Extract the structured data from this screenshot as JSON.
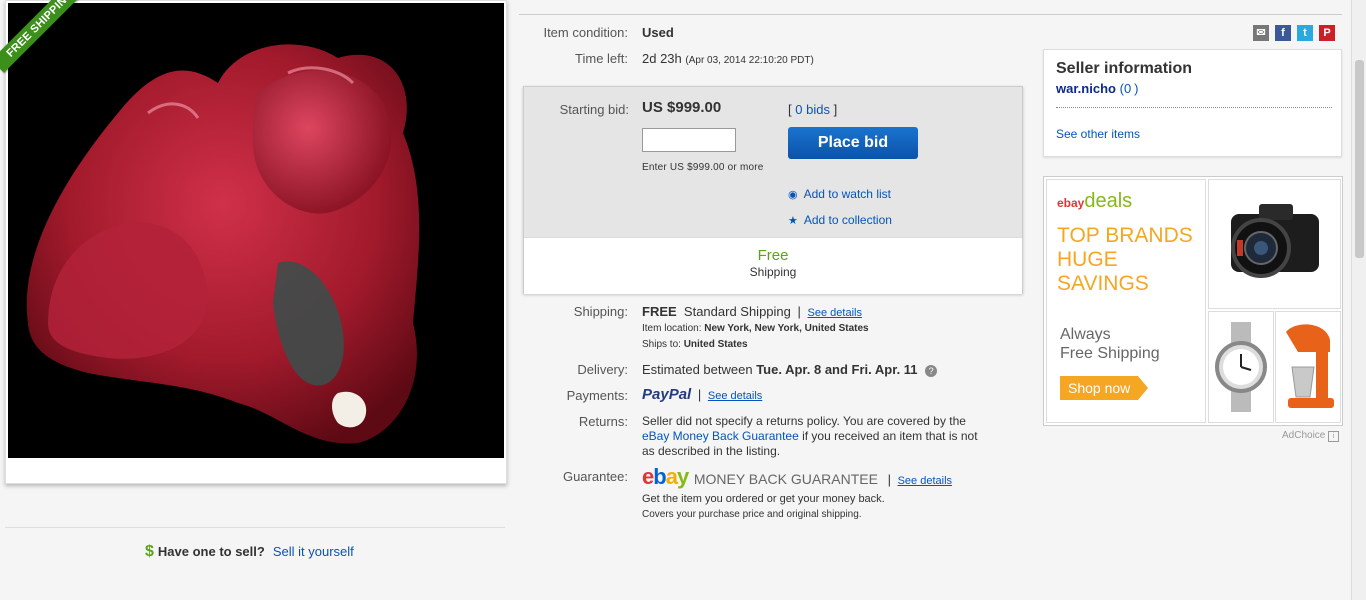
{
  "ribbon": "FREE SHIPPING",
  "sell": {
    "question": "Have one to sell?",
    "link": "Sell it yourself",
    "icon": "dollar-icon"
  },
  "details": {
    "condition_label": "Item condition:",
    "condition_value": "Used",
    "time_label": "Time left:",
    "time_value": "2d 23h",
    "time_detail": "(Apr 03, 2014  22:10:20 PDT)"
  },
  "bid": {
    "starting_label": "Starting bid:",
    "starting_value": "US $999.00",
    "bids_open": "[",
    "bids_link": "0 bids",
    "bids_close": "]",
    "input_value": "",
    "hint": "Enter US $999.00 or more",
    "place_bid": "Place bid",
    "watch": "Add to watch list",
    "collection": "Add to collection",
    "ship_title": "Free",
    "ship_sub": "Shipping"
  },
  "shipping": {
    "label": "Shipping:",
    "free": "FREE",
    "method": "Standard Shipping",
    "see_details": "See details",
    "location_label": "Item location:",
    "location_value": "New York, New York, United States",
    "ships_label": "Ships to:",
    "ships_value": "United States"
  },
  "delivery": {
    "label": "Delivery:",
    "prefix": "Estimated between",
    "dates": "Tue. Apr. 8 and Fri. Apr. 11"
  },
  "payments": {
    "label": "Payments:",
    "paypal": "PayPal",
    "see_details": "See details"
  },
  "returns": {
    "label": "Returns:",
    "line1": "Seller did not specify a returns policy. You are covered by the",
    "link": "eBay Money Back Guarantee",
    "line2": " if you received an item that is not",
    "line3": "as described in the listing."
  },
  "guarantee": {
    "label": "Guarantee:",
    "ebay": "ebay",
    "title": "MONEY BACK GUARANTEE",
    "see_details": "See details",
    "line1": "Get the item you ordered or get your money back.",
    "line2": "Covers your purchase price and original shipping."
  },
  "seller": {
    "title": "Seller information",
    "name": "war.nicho",
    "feedback_open": "(",
    "feedback": "0",
    "feedback_close": ")",
    "see_other": "See other items"
  },
  "ad": {
    "logo_ebay": "ebay",
    "logo_deals": "deals",
    "line1": "TOP BRANDS",
    "line2": "HUGE",
    "line3": "SAVINGS",
    "always1": "Always",
    "always2": "Free Shipping",
    "cta": "Shop now",
    "adchoice": "AdChoice"
  },
  "share_icons": [
    "email-icon",
    "facebook-icon",
    "twitter-icon",
    "pinterest-icon"
  ],
  "colors": {
    "accent_blue": "#0654ba",
    "button_blue": "#0b52a9",
    "free_green": "#5ba317",
    "deals_orange": "#f5a623"
  }
}
